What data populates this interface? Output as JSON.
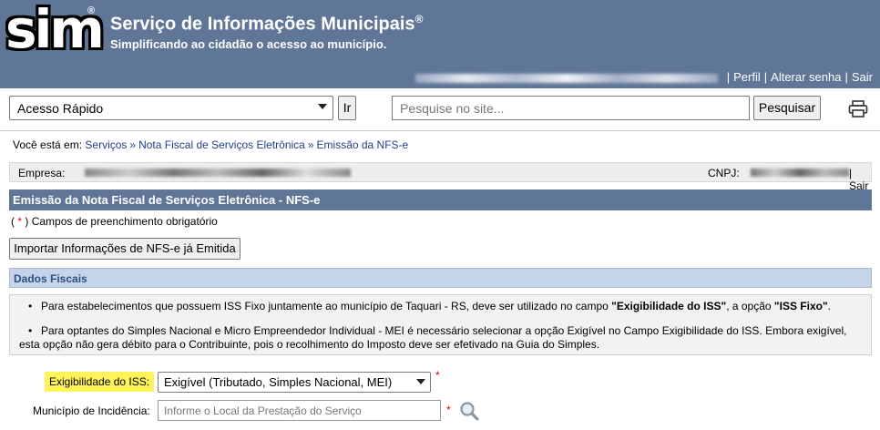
{
  "header": {
    "logo": "sim",
    "logo_mark": "®",
    "title": "Serviço de Informações Municipais",
    "title_mark": "®",
    "subtitle": "Simplificando ao cidadão o acesso ao município.",
    "links": [
      "Perfil",
      "Alterar senha",
      "Sair"
    ],
    "separator": "|"
  },
  "toolbar": {
    "quick_access_value": "Acesso Rápido",
    "go_label": "Ir",
    "search_placeholder": "Pesquise no site...",
    "search_label": "Pesquisar",
    "print_icon": "printer-icon"
  },
  "breadcrumb": {
    "prefix": "Você está em:",
    "items": [
      "Serviços",
      "Nota Fiscal de Serviços Eletrônica",
      "Emissão da NFS-e"
    ],
    "separator": "»"
  },
  "company": {
    "empresa_label": "Empresa:",
    "cnpj_label": "CNPJ:",
    "sair_label": "| Sair"
  },
  "section": {
    "title": "Emissão da Nota Fiscal de Serviços Eletrônica - NFS-e",
    "required_open": "(",
    "required_star": "*",
    "required_text": ") Campos de preenchimento obrigatório",
    "import_button": "Importar Informações de NFS-e já Emitida"
  },
  "fiscal": {
    "title": "Dados Fiscais",
    "info1_a": "Para estabelecimentos que possuem ISS Fixo juntamente ao município de Taquari - RS, deve ser utilizado no campo ",
    "info1_b": "\"Exigibilidade do ISS\"",
    "info1_c": ", a opção ",
    "info1_d": "\"ISS Fixo\"",
    "info1_e": ".",
    "info2_a": "Para optantes do Simples Nacional e Micro Empreendedor Individual - MEI é necessário selecionar a opção Exigível no Campo Exigibilidade do ISS. Embora exigível,",
    "info2_b": "esta opção não gera débito para o Contribuinte, pois o recolhimento do Imposto deve ser efetivado na Guia do Simples."
  },
  "form": {
    "exig_label": "Exigibilidade do ISS:",
    "exig_value": "Exigível (Tributado, Simples Nacional, MEI)",
    "mun_label": "Município de Incidência:",
    "mun_placeholder": "Informe o Local da Prestação do Serviço",
    "star": "*"
  },
  "colors": {
    "header_bg": "#5f7697",
    "subsection_bg": "#c5d4e8",
    "highlight": "#fff35a",
    "link": "#1e3f8a",
    "required": "#dd0000"
  }
}
